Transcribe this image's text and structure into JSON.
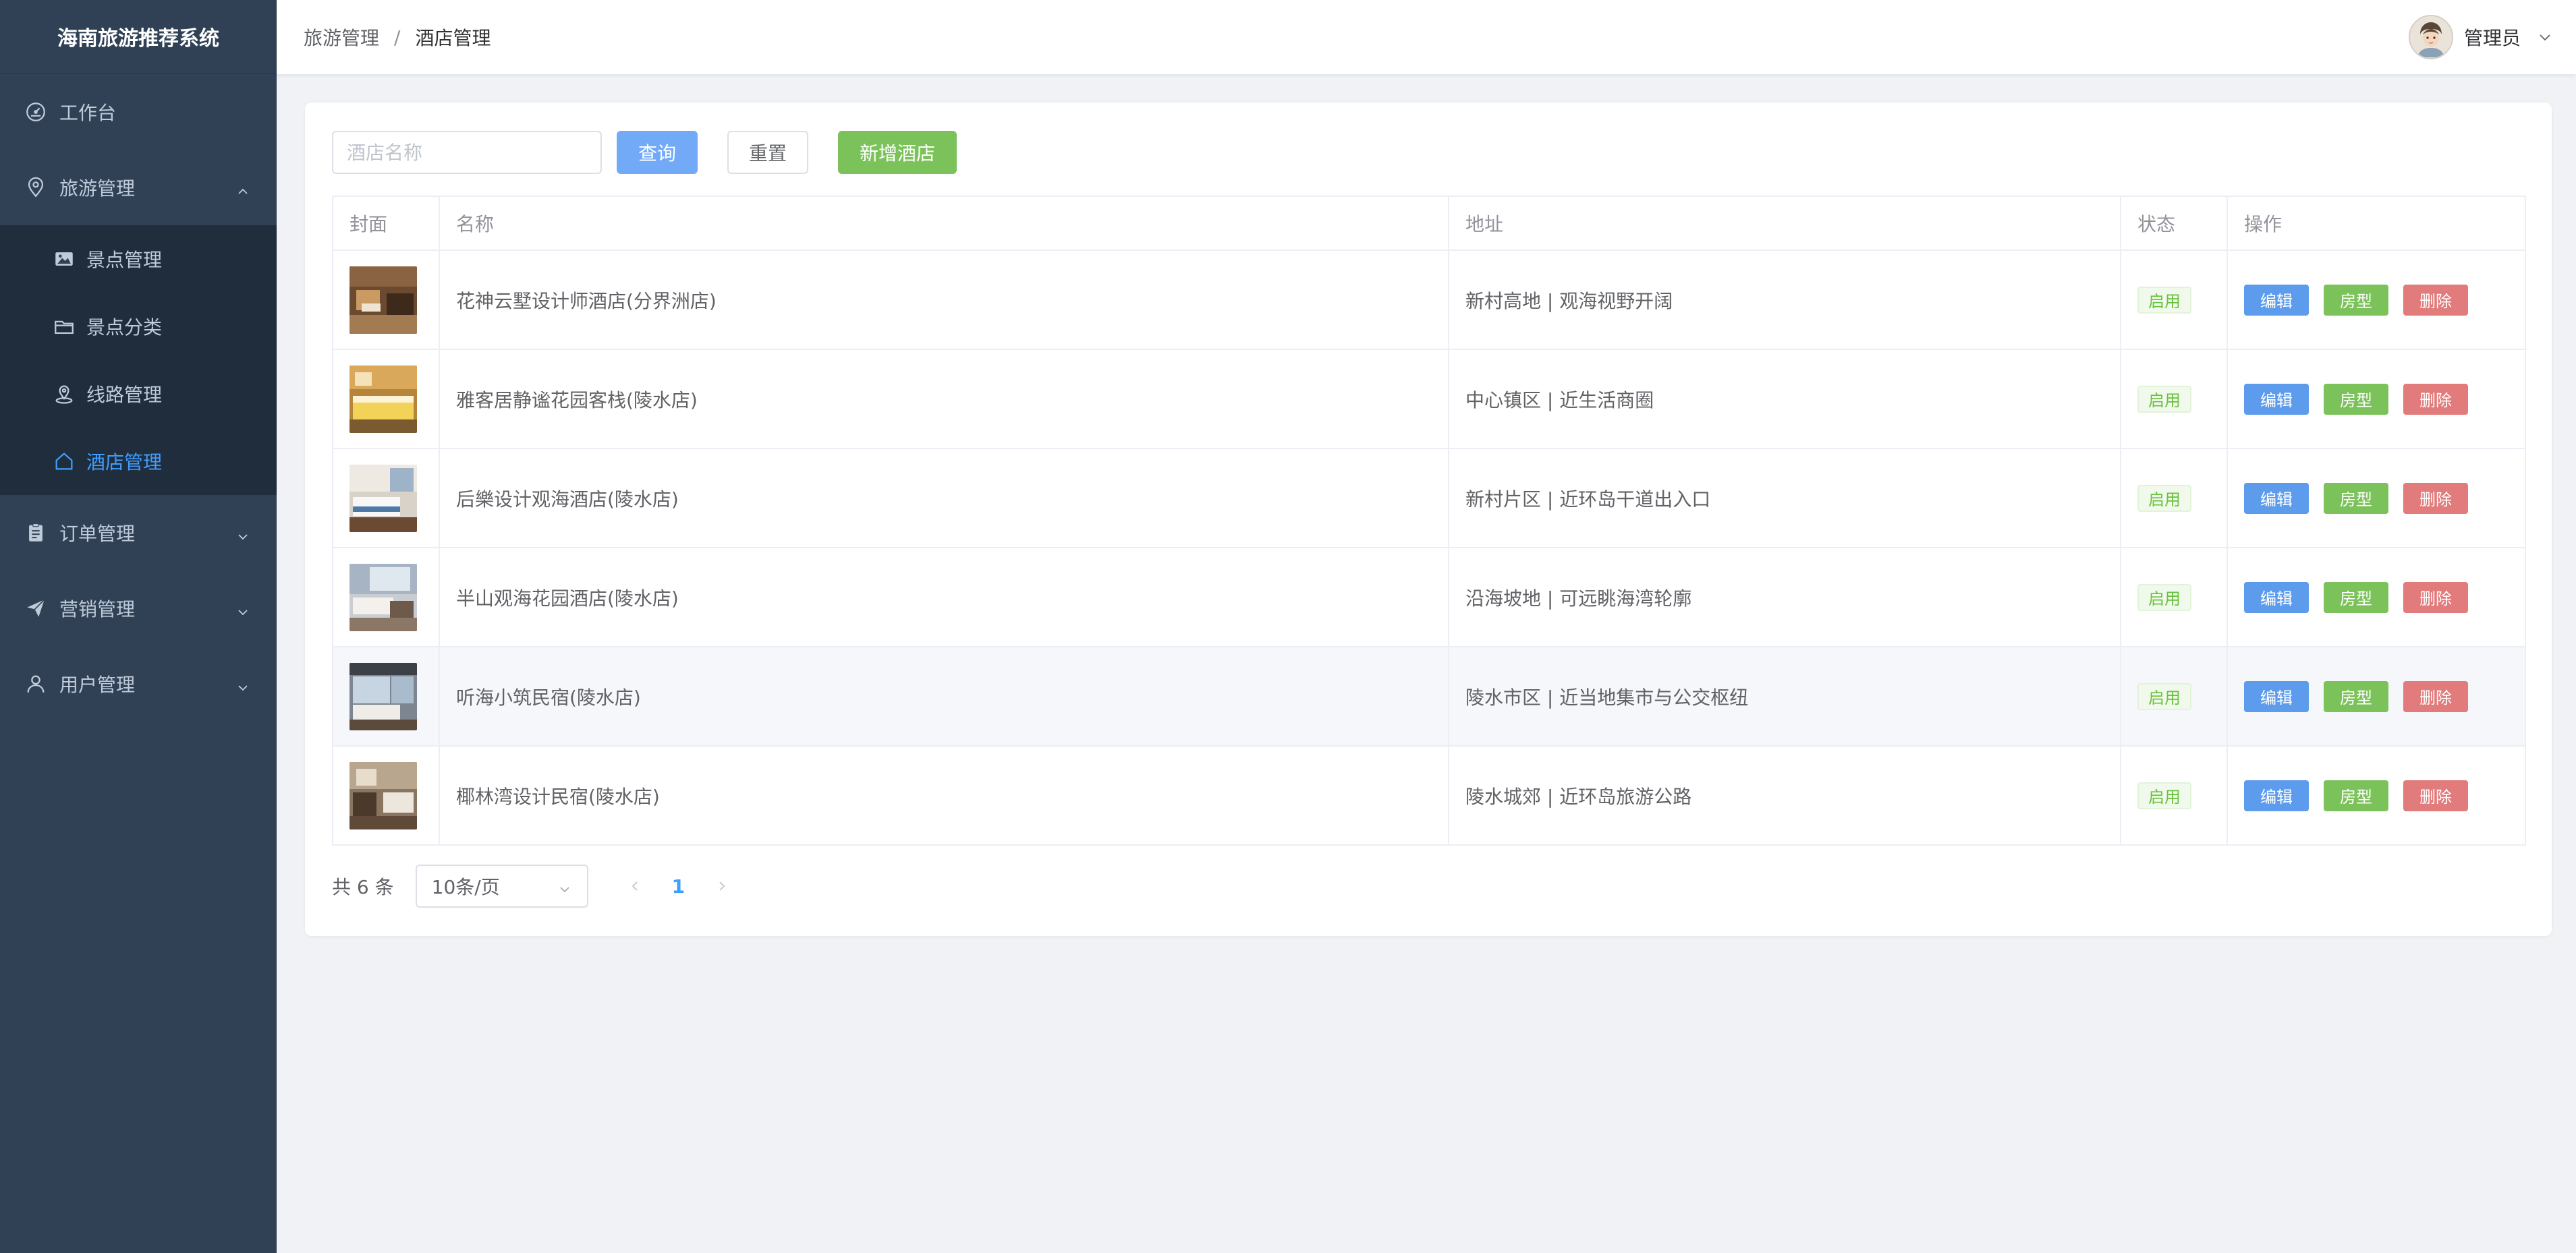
{
  "app": {
    "title": "海南旅游推荐系统"
  },
  "sidebar": {
    "items": [
      {
        "label": "工作台",
        "icon": "dashboard-icon"
      },
      {
        "label": "旅游管理",
        "icon": "location-icon",
        "expanded": true,
        "children": [
          {
            "label": "景点管理",
            "icon": "picture-icon"
          },
          {
            "label": "景点分类",
            "icon": "folder-icon"
          },
          {
            "label": "线路管理",
            "icon": "map-location-icon"
          },
          {
            "label": "酒店管理",
            "icon": "house-icon",
            "active": true
          }
        ]
      },
      {
        "label": "订单管理",
        "icon": "clipboard-icon"
      },
      {
        "label": "营销管理",
        "icon": "send-icon"
      },
      {
        "label": "用户管理",
        "icon": "user-icon"
      }
    ],
    "active_color": "#409eff"
  },
  "header": {
    "breadcrumb": [
      "旅游管理",
      "/",
      "酒店管理"
    ],
    "user_name": "管理员"
  },
  "toolbar": {
    "search_placeholder": "酒店名称",
    "query_label": "查询",
    "reset_label": "重置",
    "add_label": "新增酒店"
  },
  "table": {
    "columns": [
      "封面",
      "名称",
      "地址",
      "状态",
      "操作"
    ],
    "rows": [
      {
        "name": "花神云墅设计师酒店(分界洲店)",
        "address": "新村高地 | 观海视野开阔",
        "status": "启用"
      },
      {
        "name": "雅客居静谧花园客栈(陵水店)",
        "address": "中心镇区 | 近生活商圈",
        "status": "启用"
      },
      {
        "name": "后樂设计观海酒店(陵水店)",
        "address": "新村片区 | 近环岛干道出入口",
        "status": "启用"
      },
      {
        "name": "半山观海花园酒店(陵水店)",
        "address": "沿海坡地 | 可远眺海湾轮廓",
        "status": "启用"
      },
      {
        "name": "听海小筑民宿(陵水店)",
        "address": "陵水市区 | 近当地集市与公交枢纽",
        "status": "启用"
      },
      {
        "name": "椰林湾设计民宿(陵水店)",
        "address": "陵水城郊 | 近环岛旅游公路",
        "status": "启用"
      }
    ],
    "actions": {
      "edit": "编辑",
      "room": "房型",
      "delete": "删除"
    }
  },
  "pagination": {
    "total_text": "共 6 条",
    "page_size": "10条/页",
    "current_page": "1"
  },
  "colors": {
    "sidebar_bg": "#304156",
    "primary": "#409eff",
    "success": "#67c23a",
    "danger": "#e27b7b"
  }
}
